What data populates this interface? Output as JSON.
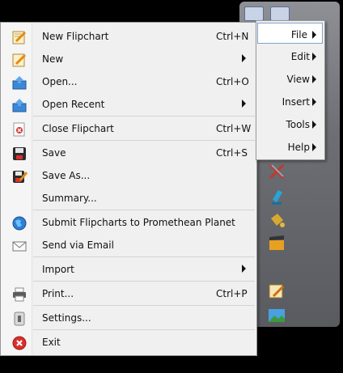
{
  "file_menu": {
    "items": [
      {
        "label": "New Flipchart",
        "shortcut": "Ctrl+N",
        "icon": "flipchart-new-icon"
      },
      {
        "label": "New",
        "shortcut": "",
        "icon": "flipchart-icon"
      },
      {
        "label": "Open...",
        "shortcut": "Ctrl+O",
        "icon": "folder-open-icon"
      },
      {
        "label": "Open Recent",
        "shortcut": "",
        "icon": "folder-recent-icon"
      },
      {
        "label": "Close Flipchart",
        "shortcut": "Ctrl+W",
        "icon": "close-document-icon"
      },
      {
        "label": "Save",
        "shortcut": "Ctrl+S",
        "icon": "floppy-disk-icon"
      },
      {
        "label": "Save As...",
        "shortcut": "",
        "icon": "floppy-disk-edit-icon"
      },
      {
        "label": "Summary...",
        "shortcut": "",
        "icon": ""
      },
      {
        "label": "Submit Flipcharts to Promethean Planet",
        "shortcut": "",
        "icon": "globe-icon"
      },
      {
        "label": "Send via Email",
        "shortcut": "",
        "icon": "envelope-icon"
      },
      {
        "label": "Import",
        "shortcut": "",
        "icon": ""
      },
      {
        "label": "Print...",
        "shortcut": "Ctrl+P",
        "icon": "printer-icon"
      },
      {
        "label": "Settings...",
        "shortcut": "",
        "icon": "settings-icon"
      },
      {
        "label": "Exit",
        "shortcut": "",
        "icon": "exit-icon"
      }
    ]
  },
  "main_menu": {
    "items": [
      {
        "label": "File"
      },
      {
        "label": "Edit"
      },
      {
        "label": "View"
      },
      {
        "label": "Insert"
      },
      {
        "label": "Tools"
      },
      {
        "label": "Help"
      }
    ]
  },
  "colors": {
    "menu_bg": "#f0f0f0",
    "highlight_border": "#7ea3c9",
    "exit_red": "#d9302c"
  }
}
